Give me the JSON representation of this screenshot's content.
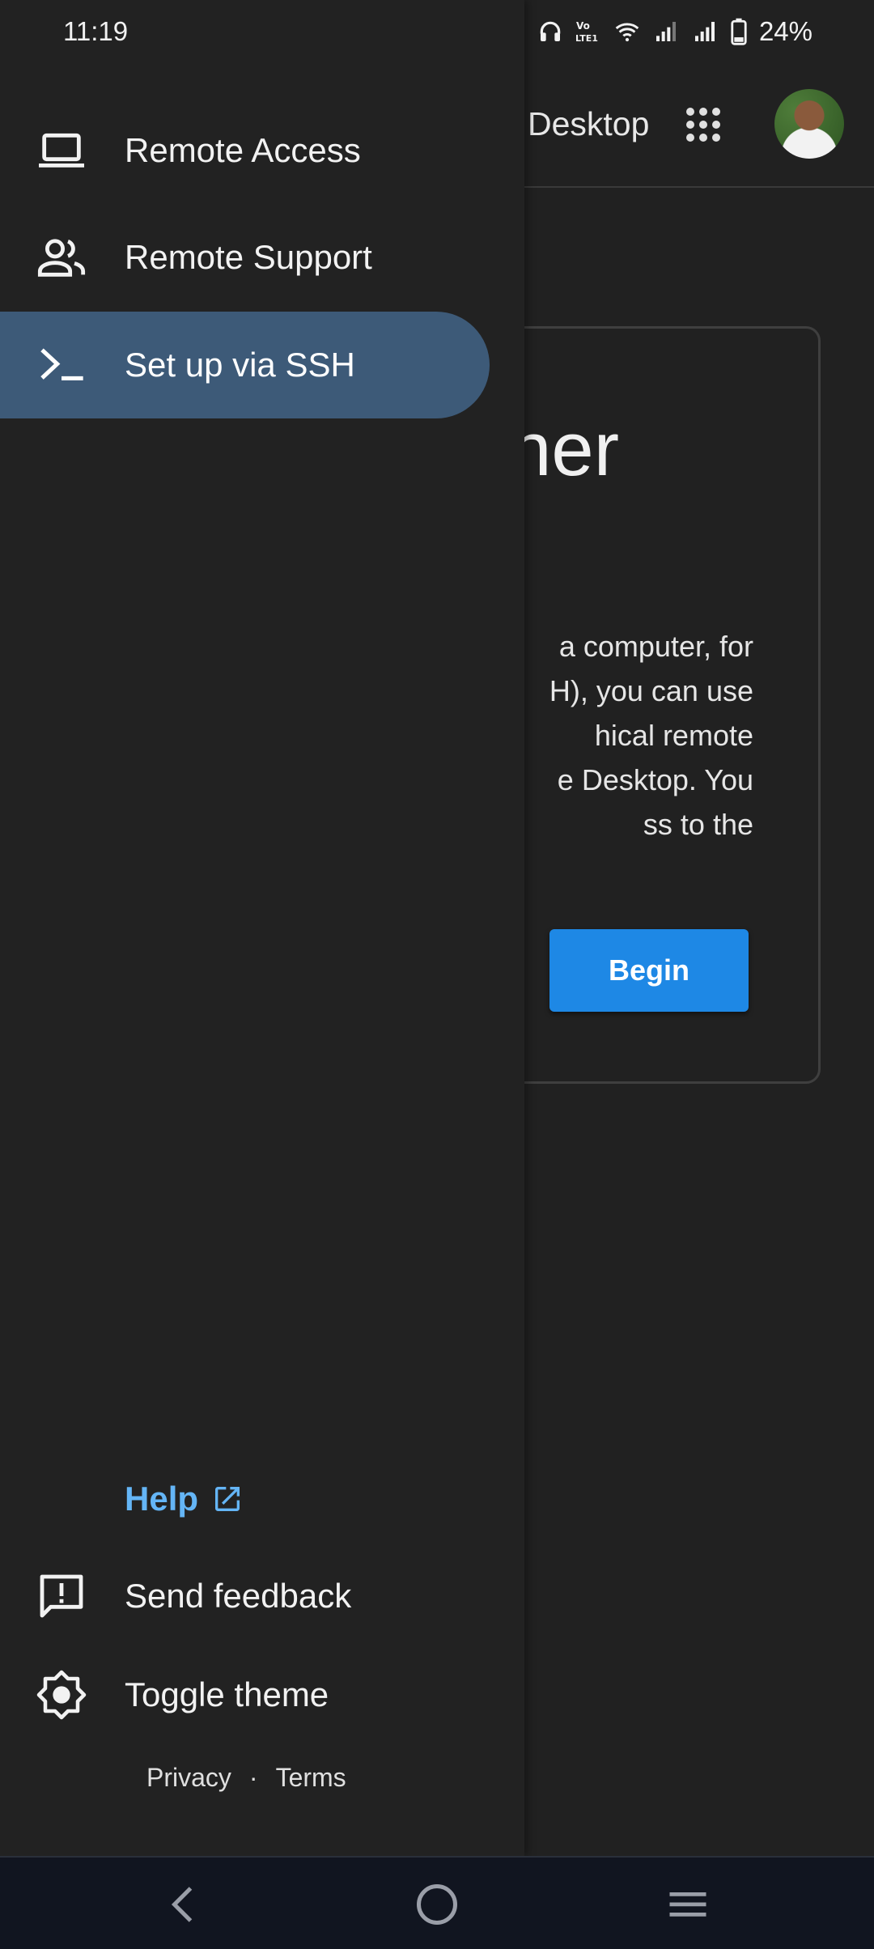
{
  "status_bar": {
    "time": "11:19",
    "battery": "24%",
    "icons": [
      "headphones-icon",
      "volte-icon",
      "wifi-icon",
      "signal-icon",
      "signal-icon",
      "battery-icon"
    ]
  },
  "app": {
    "title_fragment": "Desktop",
    "card": {
      "heading_fragment": "ner",
      "body_lines": [
        "a computer, for",
        "H), you can use",
        "hical remote",
        "e Desktop. You",
        "ss to the"
      ],
      "begin_label": "Begin"
    }
  },
  "drawer": {
    "items": [
      {
        "label": "Remote Access",
        "icon": "laptop-icon",
        "active": false
      },
      {
        "label": "Remote Support",
        "icon": "people-icon",
        "active": false
      },
      {
        "label": "Set up via SSH",
        "icon": "terminal-icon",
        "active": true
      }
    ],
    "help_label": "Help",
    "feedback_label": "Send feedback",
    "theme_label": "Toggle theme",
    "privacy_label": "Privacy",
    "separator": "·",
    "terms_label": "Terms"
  },
  "colors": {
    "accent": "#1e88e5",
    "active_item": "#3d5a78",
    "link": "#64b5f6",
    "background": "#212121"
  }
}
